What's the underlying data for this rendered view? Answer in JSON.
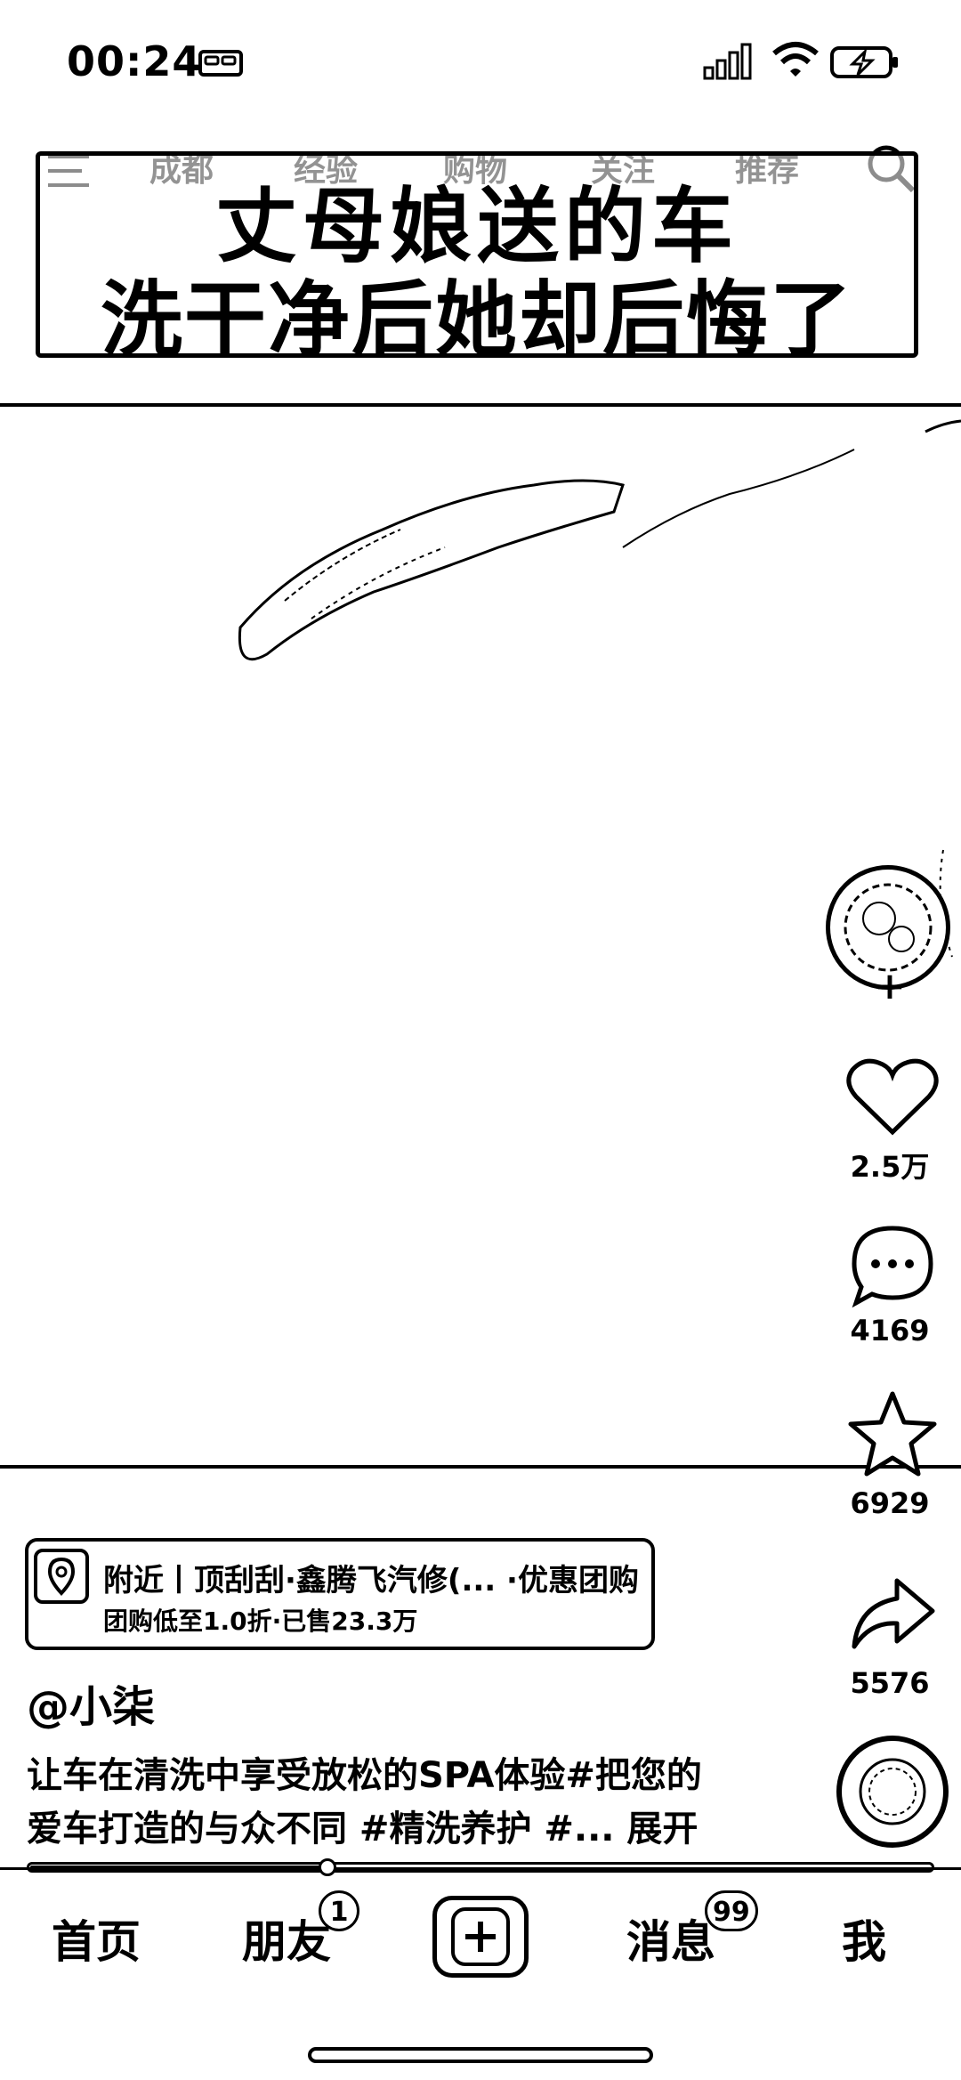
{
  "status_bar": {
    "time": "00:24"
  },
  "top_nav": {
    "tabs": [
      "成都",
      "经验",
      "购物",
      "关注",
      "推荐"
    ]
  },
  "title_overlay": {
    "line1": "丈母娘送的车",
    "line2": "洗干净后她却后悔了"
  },
  "actions": {
    "likes": "2.5万",
    "comments": "4169",
    "favorites": "6929",
    "shares": "5576"
  },
  "location_card": {
    "title": "附近丨顶刮刮·鑫腾飞汽修(... ·优惠团购",
    "subtitle": "团购低至1.0折·已售23.3万"
  },
  "post": {
    "author": "@小柒",
    "caption_line1": "让车在清洗中享受放松的SPA体验#把您的",
    "caption_line2": "爱车打造的与众不同 #精洗养护 #... 展开"
  },
  "playback": {
    "progress": 0.33
  },
  "bottom_tabs": {
    "home": "首页",
    "friends": "朋友",
    "friends_badge": "1",
    "messages": "消息",
    "messages_badge": "99",
    "me": "我"
  }
}
